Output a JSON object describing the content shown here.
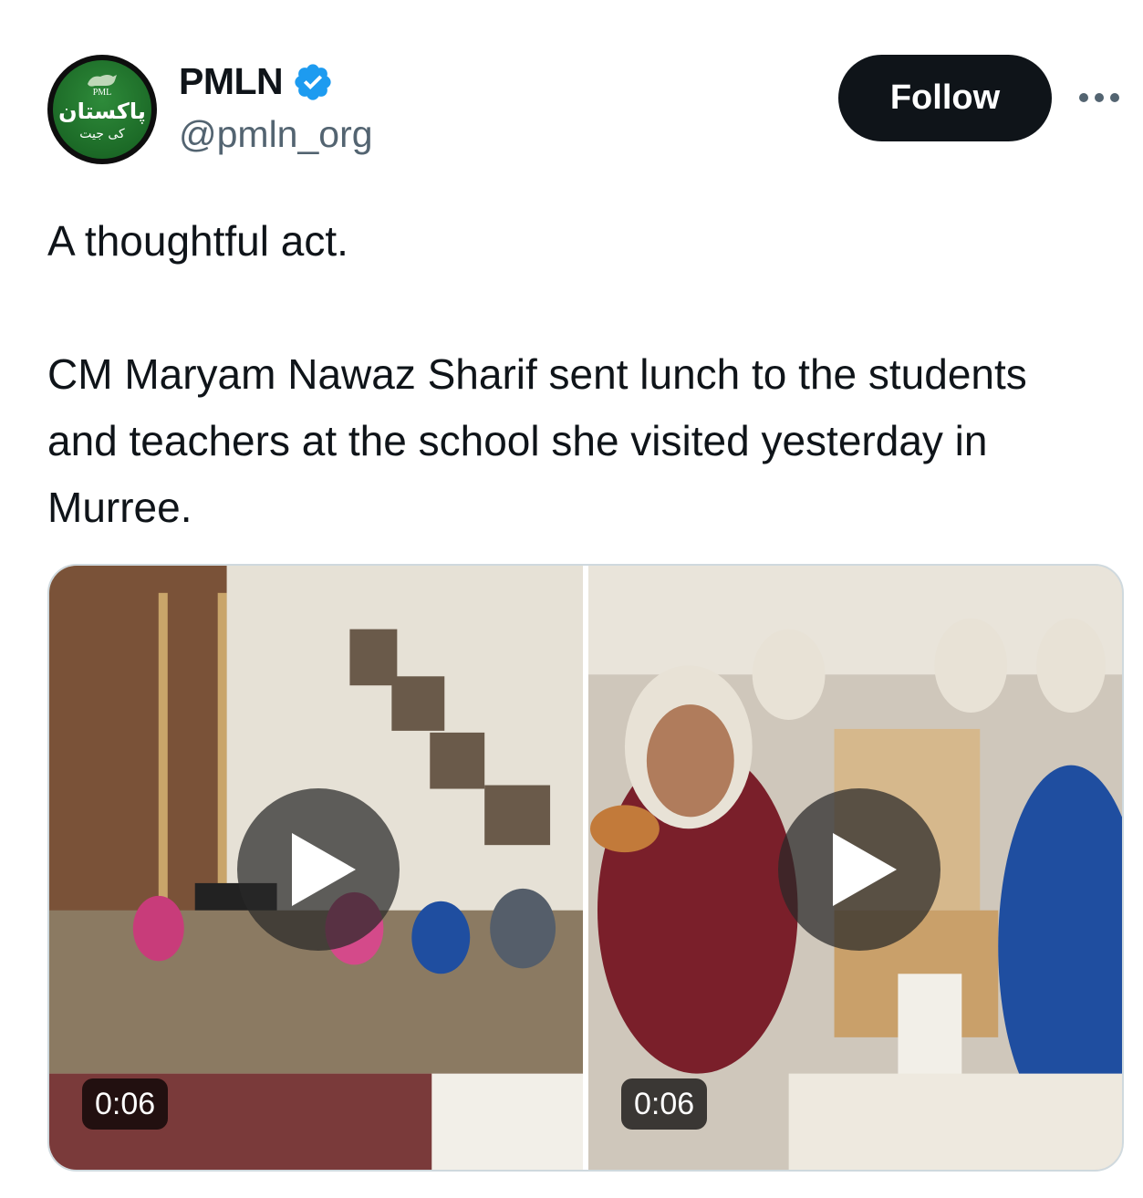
{
  "author": {
    "display_name": "PMLN",
    "handle": "@pmln_org",
    "verified": true,
    "avatar": {
      "logo_text": "PML",
      "urdu_line1": "پاکستان",
      "urdu_line2": "کی جیت"
    }
  },
  "follow_label": "Follow",
  "more_icon": "more-horizontal-icon",
  "tweet": {
    "line1": "A thoughtful act.",
    "line2": "CM Maryam Nawaz Sharif sent lunch to the students and teachers at the school she visited yesterday in Murree."
  },
  "media": [
    {
      "type": "video",
      "duration": "0:06",
      "icon": "play-icon"
    },
    {
      "type": "video",
      "duration": "0:06",
      "icon": "play-icon"
    }
  ],
  "colors": {
    "text": "#0f1419",
    "secondary_text": "#536471",
    "follow_bg": "#0f1419",
    "verified_blue": "#1d9bf0",
    "avatar_green": "#1c6a27"
  }
}
